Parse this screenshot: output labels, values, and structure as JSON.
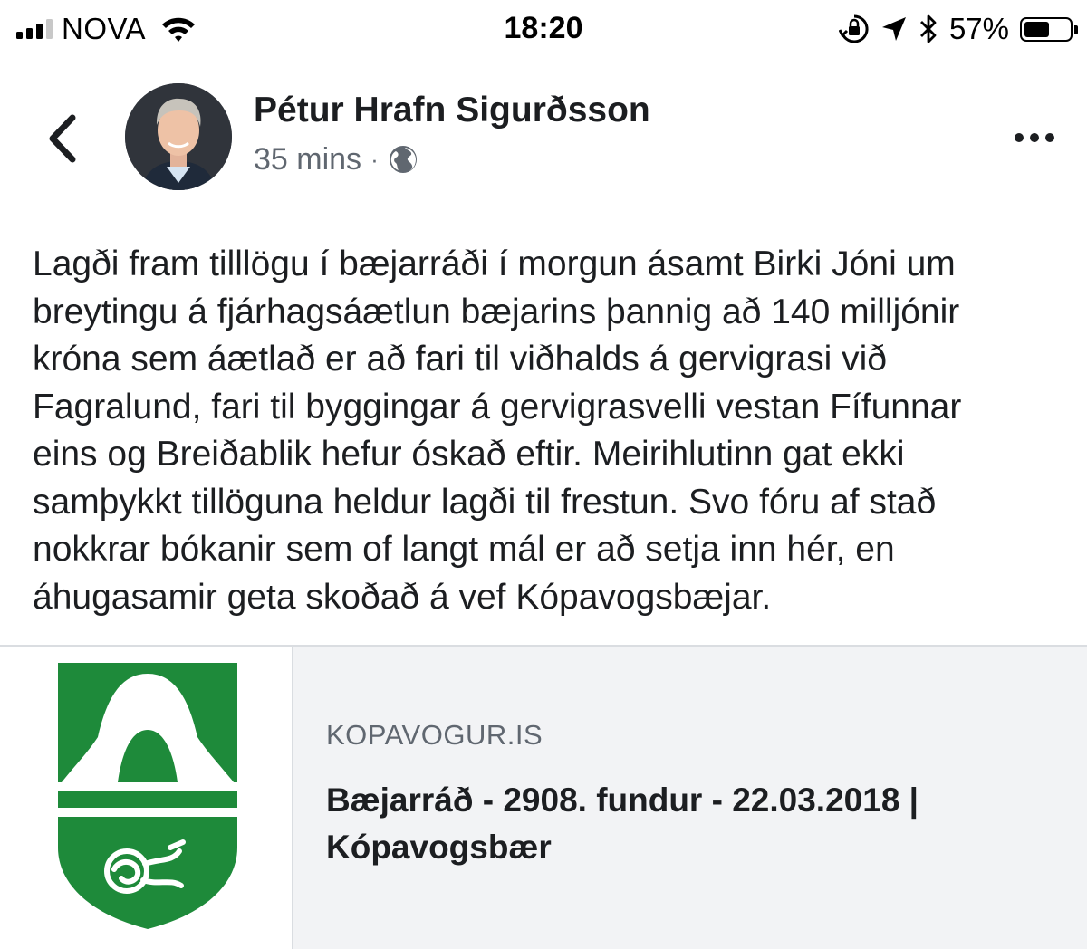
{
  "status_bar": {
    "carrier": "NOVA",
    "time": "18:20",
    "battery_percent": "57%",
    "battery_level": 0.57,
    "signal_bars_filled": 3,
    "signal_bars_total": 4,
    "icons": [
      "wifi-icon",
      "rotation-lock-icon",
      "location-arrow-icon",
      "bluetooth-icon",
      "battery-icon"
    ]
  },
  "post": {
    "author": "Pétur Hrafn Sigurðsson",
    "timestamp": "35 mins",
    "separator": "·",
    "audience_icon": "globe-icon",
    "text_lines": [
      "Lagði fram tilllögu í bæjarráði í morgun ásamt Birki Jóni um",
      "breytingu á fjárhagsáætlun bæjarins þannig að 140 milljónir",
      "króna sem áætlað er að fari til viðhalds á gervigrasi við",
      "Fagralund, fari til byggingar á gervigrasvelli vestan Fífunnar",
      "eins og Breiðablik hefur óskað eftir. Meirihlutinn gat ekki",
      "samþykkt tillöguna heldur lagði til frestun. Svo fóru af stað",
      "nokkrar bókanir sem of langt mál er að setja inn hér, en",
      "áhugasamir geta skoðað á vef Kópavogsbæjar."
    ]
  },
  "link_card": {
    "domain": "KOPAVOGUR.IS",
    "title": "Bæjarráð - 2908. fundur - 22.03.2018 | Kópavogsbær",
    "thumbnail": "kopavogur-coat-of-arms",
    "colors": {
      "shield_green": "#1e8a3a",
      "background": "#f2f3f5"
    }
  },
  "colors": {
    "text_primary": "#1c1e21",
    "text_secondary": "#606770",
    "divider": "#dadde1"
  }
}
